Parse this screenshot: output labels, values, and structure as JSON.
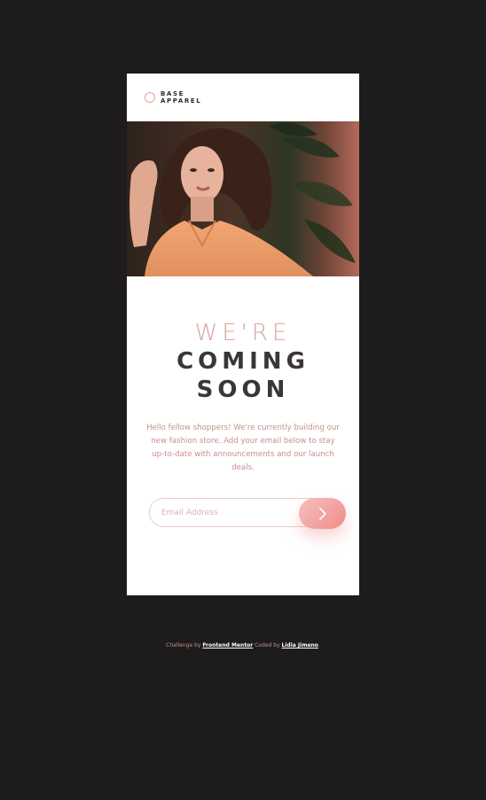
{
  "brand": {
    "line1": "BASE",
    "line2": "APPAREL"
  },
  "hero": {
    "image": "woman-in-peach-shirt-photo"
  },
  "headline": {
    "line1": "WE'RE",
    "line2": "COMING",
    "line3": "SOON"
  },
  "description": "Hello fellow shoppers! We're currently building our new fashion store. Add your email below to stay up-to-date with announcements and our launch deals.",
  "form": {
    "email_placeholder": "Email Address",
    "submit_icon": "chevron-right-icon"
  },
  "footer": {
    "prefix": "Challenge by",
    "challenge_link": "Frontend Mentor",
    "middle": "Coded by",
    "author_link": "Lidia Jimeno",
    "suffix": "."
  },
  "colors": {
    "background": "#1d1b1b",
    "accent": "#f29a9a",
    "headline_light": "#d8a4a0",
    "headline_dark": "#3a3636",
    "text": "#c78f8a"
  }
}
